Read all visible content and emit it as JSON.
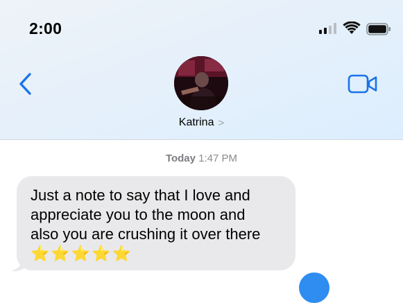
{
  "status_bar": {
    "time": "2:00",
    "signal_bars_active": 2,
    "signal_bars_total": 4
  },
  "header": {
    "contact_name": "Katrina",
    "chevron": ">",
    "accent_color": "#1a73e8",
    "back_icon": "chevron-left-icon",
    "video_icon": "video-camera-icon"
  },
  "thread": {
    "timestamp_day": "Today",
    "timestamp_time": "1:47 PM",
    "messages": [
      {
        "lines": [
          "Just a note to say that I love and",
          "appreciate you to the moon and",
          "also you are crushing it over there"
        ],
        "emoji": "⭐⭐⭐⭐⭐"
      }
    ]
  }
}
